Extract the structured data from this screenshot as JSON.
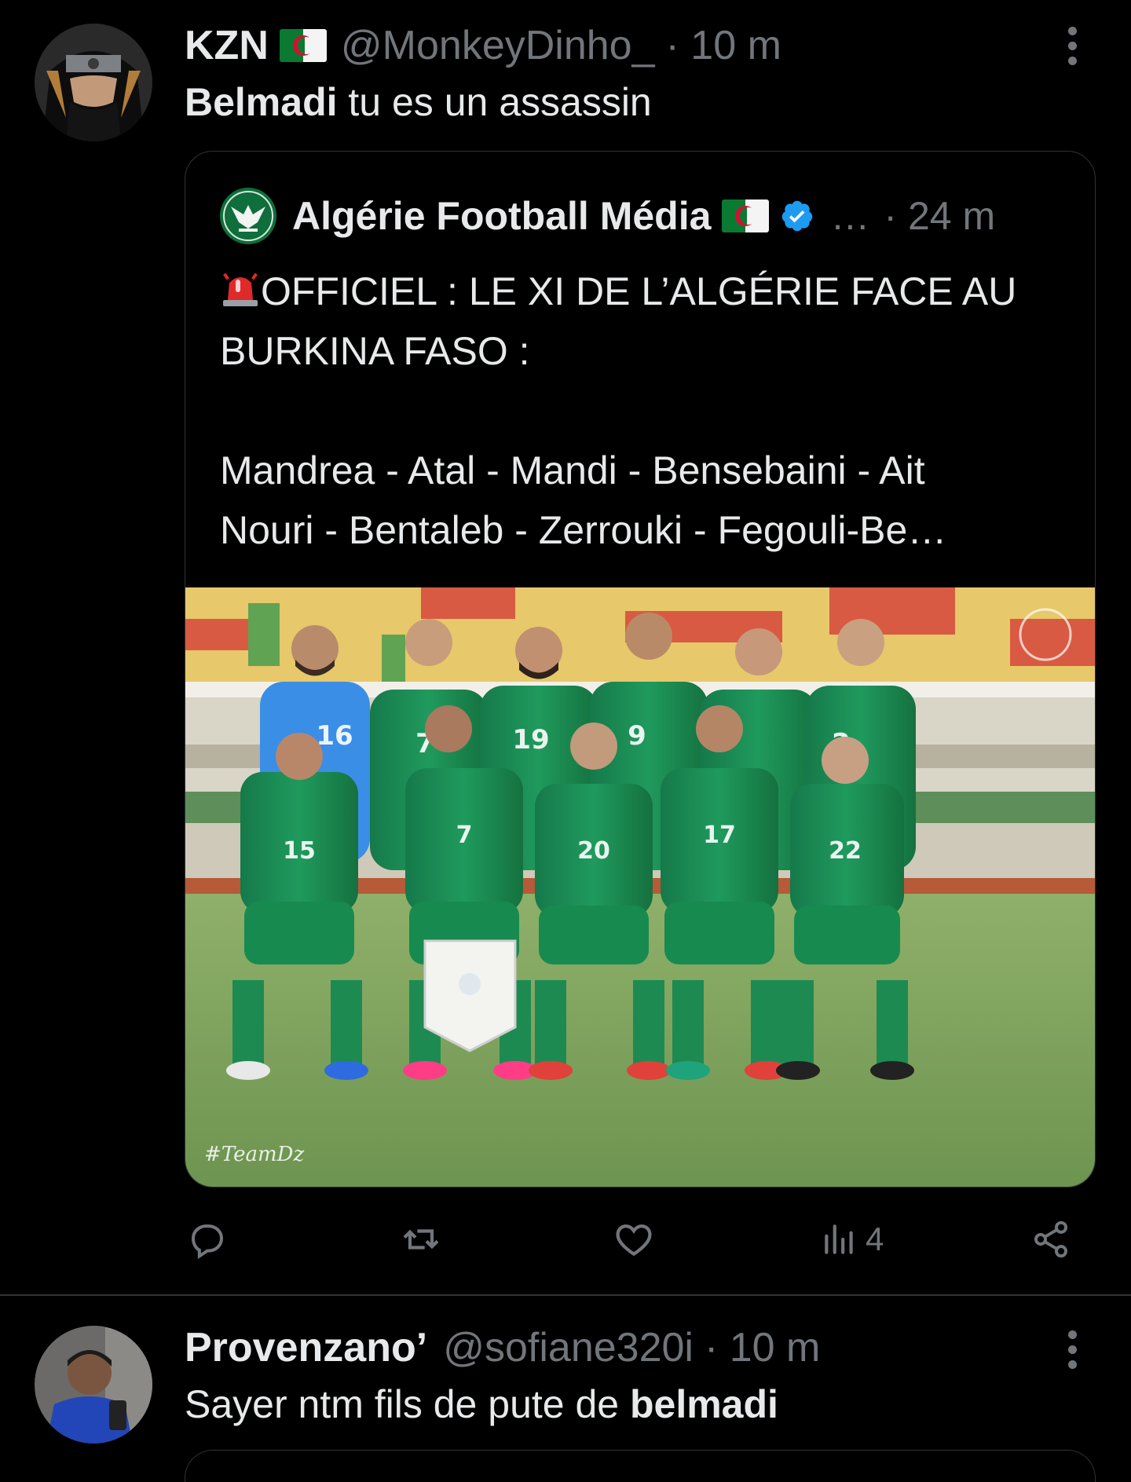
{
  "tweet1": {
    "display_name": "KZN",
    "handle": "@MonkeyDinho_",
    "time": "· 10 m",
    "text_bold": "Belmadi",
    "text_rest": " tu es un assassin"
  },
  "quote": {
    "display_name": "Algérie Football Média",
    "ellipsis": "…",
    "time": "· 24 m",
    "lines": [
      "OFFICIEL : LE XI DE L’ALGÉRIE FACE AU",
      "BURKINA FASO :",
      "Mandrea - Atal - Mandi - Bensebaini - Ait",
      "Nouri - Bentaleb - Zerrouki - Fegouli-Be…"
    ],
    "photo_watermark": "#TeamDz",
    "shirt_numbers_back": [
      "16",
      "7",
      "19",
      "9",
      "",
      "2"
    ],
    "shirt_numbers_front": [
      "15",
      "7",
      "20",
      "17",
      "22"
    ]
  },
  "actions": {
    "views": "4"
  },
  "tweet2": {
    "display_name": "Provenzano’",
    "handle": "@sofiane320i",
    "time": "· 10 m",
    "text_rest": "Sayer ntm fils de pute de ",
    "text_bold": "belmadi"
  },
  "colors": {
    "background": "#000000",
    "text": "#e7e9ea",
    "muted": "#71767b",
    "border": "#2f3336",
    "verified": "#1d9bf0"
  },
  "icons": [
    "reply-icon",
    "retweet-icon",
    "like-icon",
    "views-icon",
    "share-icon",
    "more-icon",
    "verified-icon",
    "siren-icon",
    "algeria-flag-icon"
  ]
}
